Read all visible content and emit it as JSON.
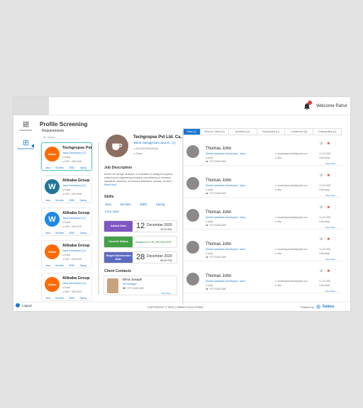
{
  "header": {
    "welcome": "Welcome Rahul",
    "bell_icon": "bell-icon"
  },
  "sidebar": {
    "items": [
      {
        "label": "Dashboard",
        "icon": "dashboard-icon"
      },
      {
        "label": "Requirements",
        "icon": "requirements-icon"
      }
    ],
    "logout": "Logout"
  },
  "page": {
    "title": "Profile Screening",
    "subtitle": "Requirements",
    "search_placeholder": "Search"
  },
  "requirements": [
    {
      "name": "Techgropse Pvt...",
      "role": "Java Developer (1)",
      "location": "Dubai",
      "salary": "1000 - 1500 AED",
      "skills": [
        "Java",
        "Servlets",
        "JDBC",
        "Spring"
      ],
      "logo": "Alibaba",
      "logo_color": "#ff6a00"
    },
    {
      "name": "Alibaba Group",
      "role": "Java Developer (1)",
      "location": "Dubai",
      "salary": "1000 - 1500 AED",
      "skills": [
        "Java",
        "Servlets",
        "JDBC",
        "Spring"
      ],
      "logo": "W",
      "logo_color": "#21759b"
    },
    {
      "name": "Alibaba Group",
      "role": "Java Developer (1)",
      "location": "Dubai",
      "salary": "1000 - 1500 AED",
      "skills": [
        "Java",
        "Servlets",
        "JDBC",
        "Spring"
      ],
      "logo": "W",
      "logo_color": "#1e88e5"
    },
    {
      "name": "Alibaba Group",
      "role": "Java Developer (1)",
      "location": "Dubai",
      "salary": "1000 - 1500 AED",
      "skills": [
        "Java",
        "Servlets",
        "JDBC",
        "Spring"
      ],
      "logo": "Alibaba",
      "logo_color": "#ff6a00"
    },
    {
      "name": "Alibaba Group",
      "role": "Java Developer (1)",
      "location": "Dubai",
      "salary": "1000 - 1500 AED",
      "skills": [
        "Java",
        "Servlets",
        "JDBC",
        "Spring"
      ],
      "logo": "Alibaba",
      "logo_color": "#ff6a00"
    }
  ],
  "detail": {
    "company": "Techgropse Pvt Ltd. Ca...",
    "role": "Talent management Java D.. (1)",
    "code": "ENTUS20200160004",
    "location": "Dubai",
    "jd_title": "Job Description",
    "jd_text": "secure the design, analysis, or evaluation of assigned projects using sound engineering principles and adhering to business standards, practices, procedures standards, practice, product...",
    "read_more": "Read More",
    "skills_title": "Skills",
    "skills": [
      "Java",
      "Servlets",
      "JDBC",
      "Spring",
      "Core Java"
    ],
    "added": {
      "label": "Added Date",
      "day": "12",
      "month": "December 2020",
      "time": "10:00 AM",
      "color": "#7e57c2"
    },
    "status": {
      "label": "Current Status",
      "value": "Assigned to HR_RECRUITER",
      "color": "#43a047"
    },
    "target": {
      "label": "Target Submission Date",
      "day": "28",
      "month": "December 2020",
      "time": "05:00 PM",
      "color": "#5c6bc0"
    },
    "contacts_title": "Client Contacts",
    "contact": {
      "name": "Elina Joseph",
      "role": "HR Manager",
      "phone": "+971 544611480",
      "view_more": "View More"
    }
  },
  "tabs": [
    {
      "label": "New (1)",
      "active": true
    },
    {
      "label": "Sent to Client (2)",
      "active": false
    },
    {
      "label": "Archived (1)",
      "active": false
    },
    {
      "label": "Shortlisted (0)",
      "active": false
    },
    {
      "label": "Confirmed (2)",
      "active": false
    },
    {
      "label": "Onboarding (1)",
      "active": false
    }
  ],
  "candidates": [
    {
      "name": "Thomas John",
      "role": "Senior software developer- Java",
      "location": "Unity",
      "phone": "+971 544611480",
      "email": "venkataprasanthi@gmail.com",
      "visa": "Visa",
      "experience": "3 Month(s)",
      "date": "12-12-2020",
      "view_more": "View More"
    },
    {
      "name": "Thomas John",
      "role": "Senior software developer- Java",
      "location": "Unity",
      "phone": "+971 544611480",
      "email": "venkataprasanthi@gmail.com",
      "visa": "Visa",
      "experience": "3 Month(s)",
      "date": "12-12-2020",
      "view_more": "View More"
    },
    {
      "name": "Thomas John",
      "role": "Senior software developer- Java",
      "location": "Unity",
      "phone": "+971 544611480",
      "email": "venkataprasanthi@gmail.com",
      "visa": "Visa",
      "experience": "3 Month(s)",
      "date": "12-12-2020",
      "view_more": "View More"
    },
    {
      "name": "Thomas John",
      "role": "Senior software developer- Java",
      "location": "Unity",
      "phone": "+971 544611480",
      "email": "venkataprasanthi@gmail.com",
      "visa": "Visa",
      "experience": "3 Month(s)",
      "date": "12-12-2020",
      "view_more": "View More"
    },
    {
      "name": "Thomas John",
      "role": "Senior software developer- Java",
      "location": "Unity",
      "phone": "+971 544611480",
      "email": "venkataprasanthi@gmail.com",
      "visa": "Visa",
      "experience": "3 Month(s)",
      "date": "12-12-2020",
      "view_more": "View More"
    }
  ],
  "footer": {
    "copyright": "COPYRIGHT © 2020 | ORBIO SOLUTIONS",
    "powered": "Powere by",
    "brand": "Galaxy"
  },
  "colors": {
    "accent": "#1976d2",
    "danger": "#e53935"
  }
}
